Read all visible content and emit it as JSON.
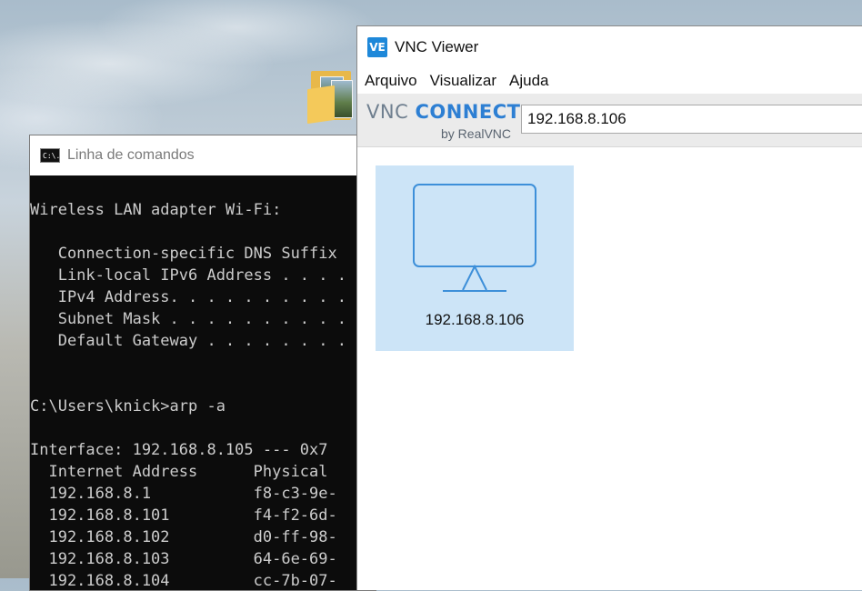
{
  "desktop": {
    "folder_icon": "folder-with-photos-icon"
  },
  "cmd": {
    "title": "Linha de comandos",
    "icon_text": "C:\\.",
    "lines": [
      "Wireless LAN adapter Wi-Fi:",
      "",
      "   Connection-specific DNS Suffix",
      "   Link-local IPv6 Address . . . .",
      "   IPv4 Address. . . . . . . . . .",
      "   Subnet Mask . . . . . . . . . .",
      "   Default Gateway . . . . . . . .",
      "",
      "",
      "C:\\Users\\knick>arp -a",
      "",
      "Interface: 192.168.8.105 --- 0x7",
      "  Internet Address      Physical",
      "  192.168.8.1           f8-c3-9e-",
      "  192.168.8.101         f4-f2-6d-",
      "  192.168.8.102         d0-ff-98-",
      "  192.168.8.103         64-6e-69-",
      "  192.168.8.104         cc-7b-07-"
    ]
  },
  "vnc": {
    "title": "VNC Viewer",
    "app_icon": "vnc-viewer-icon",
    "app_icon_text": "VE",
    "menu": [
      "Arquivo",
      "Visualizar",
      "Ajuda"
    ],
    "logo": {
      "vnc": "VNC",
      "connect": "CONNECT",
      "sub": "by RealVNC"
    },
    "address_value": "192.168.8.106",
    "connections": [
      {
        "label": "192.168.8.106",
        "icon": "monitor-icon",
        "selected": true
      }
    ],
    "colors": {
      "accent": "#2d7fd3",
      "tile_selected": "#cce4f7",
      "monitor_stroke": "#3d8fd9"
    }
  }
}
